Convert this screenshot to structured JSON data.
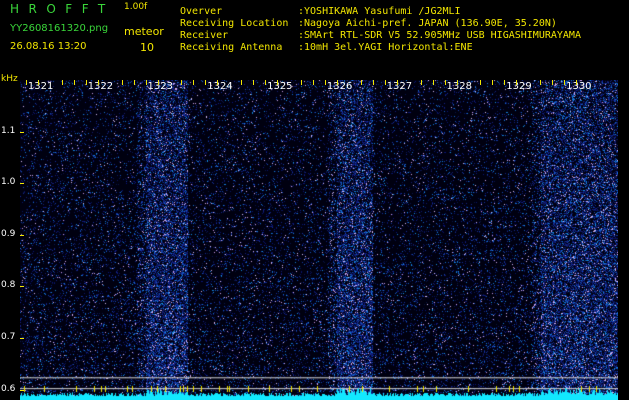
{
  "header": {
    "brand": "HROFFT",
    "version": "1.00f",
    "filename": "YY2608161320.png",
    "mode": "meteor",
    "datetime": "26.08.16 13:20",
    "count": "10"
  },
  "station": [
    {
      "label": "Overver",
      "value": ":YOSHIKAWA Yasufumi /JG2MLI"
    },
    {
      "label": "Receiving Location",
      "value": ":Nagoya Aichi-pref. JAPAN (136.90E, 35.20N)"
    },
    {
      "label": "Receiver",
      "value": ":SMArt RTL-SDR V5 52.905MHz USB HIGASHIMURAYAMA"
    },
    {
      "label": "Receiving Antenna",
      "value": ":10mH 3el.YAGI Horizontal:ENE"
    }
  ],
  "colors": {
    "background": "#000000",
    "header_green": "#3ad63a",
    "header_yellow": "#f2e600",
    "tick_text": "#ffffff",
    "signal": "#2fb8ff",
    "baseline": "#12e8ff"
  },
  "chart_data": {
    "type": "heatmap",
    "y_unit": "kHz",
    "x_ticks": [
      "1321",
      "1322",
      "1323",
      "1324",
      "1325",
      "1326",
      "1327",
      "1328",
      "1329",
      "1330"
    ],
    "y_ticks": [
      "1.1",
      "1.0",
      "0.9",
      "0.8",
      "0.7",
      "0.6"
    ],
    "xlim": [
      1320.5,
      1330.5
    ],
    "ylim": [
      0.58,
      1.2
    ],
    "reference_lines_khz": [
      0.624,
      0.603
    ],
    "bright_bands_minutes": [
      [
        1322.6,
        1323.3
      ],
      [
        1325.8,
        1326.4
      ],
      [
        1329.2,
        1330.5
      ]
    ],
    "grid": false
  }
}
